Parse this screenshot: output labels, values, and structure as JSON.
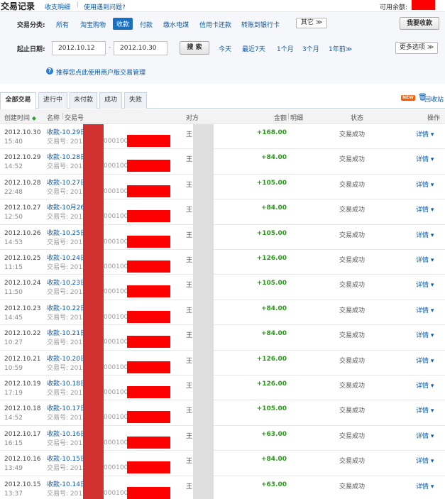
{
  "header": {
    "title": "交易记录",
    "link_statement": "收支明细",
    "link_help": "使用遇到问题?",
    "balance_label": "可用余额:"
  },
  "filter": {
    "category_label": "交易分类:",
    "categories": [
      "所有",
      "淘宝购物",
      "收款",
      "付款",
      "缴水电煤",
      "信用卡还款",
      "转账到银行卡"
    ],
    "selected_category": "收款",
    "other_button": "其它 ≫",
    "collect_button": "我要收款",
    "date_label": "起止日期:",
    "start_date": "2012.10.12",
    "date_separator": "-",
    "end_date": "2012.10.30",
    "search_button": "搜 索",
    "quick_ranges": [
      "今天",
      "最近7天",
      "1个月",
      "3个月",
      "1年前≫"
    ],
    "more_options": "更多选项 ≫",
    "tip": "推荐您点此使用商户版交易管理"
  },
  "tabs": [
    "全部交易",
    "进行中",
    "未付款",
    "成功",
    "失败"
  ],
  "active_tab": "全部交易",
  "recycle": {
    "badge": "NEW",
    "label": "回收站"
  },
  "table": {
    "headers": {
      "created": "创建时间",
      "name": "名称",
      "trade_no": "交易号",
      "counterparty": "对方",
      "amount": "金额",
      "detail": "明细",
      "status": "状态",
      "action": "操作"
    },
    "rows": [
      {
        "date": "2012.10.30",
        "time": "15:40",
        "name": "收款-10.29日",
        "no": "交易号: 2012",
        "no_tail": "0001000",
        "cp": "王",
        "amount": "+168.00",
        "status": "交易成功",
        "detail": "详情 ▾"
      },
      {
        "date": "2012.10.29",
        "time": "14:52",
        "name": "收款-10.28日",
        "no": "交易号: 2012",
        "no_tail": "0001000",
        "cp": "王",
        "amount": "+84.00",
        "status": "交易成功",
        "detail": "详情 ▾"
      },
      {
        "date": "2012.10.28",
        "time": "22:48",
        "name": "收款-10.27日",
        "no": "交易号: 2012",
        "no_tail": "0001000",
        "cp": "王",
        "amount": "+105.00",
        "status": "交易成功",
        "detail": "详情 ▾"
      },
      {
        "date": "2012.10.27",
        "time": "12:50",
        "name": "收款-10月26",
        "no": "交易号: 2012",
        "no_tail": "0001000",
        "cp": "王",
        "amount": "+84.00",
        "status": "交易成功",
        "detail": "详情 ▾"
      },
      {
        "date": "2012.10.26",
        "time": "14:53",
        "name": "收款-10.25日",
        "no": "交易号: 2012",
        "no_tail": "0001000",
        "cp": "王",
        "amount": "+105.00",
        "status": "交易成功",
        "detail": "详情 ▾"
      },
      {
        "date": "2012.10.25",
        "time": "11:15",
        "name": "收款-10.24日",
        "no": "交易号: 2012",
        "no_tail": "0001000",
        "cp": "王",
        "amount": "+126.00",
        "status": "交易成功",
        "detail": "详情 ▾"
      },
      {
        "date": "2012.10.24",
        "time": "11:50",
        "name": "收款-10.23日",
        "no": "交易号: 2012",
        "no_tail": "0001000",
        "cp": "王",
        "amount": "+105.00",
        "status": "交易成功",
        "detail": "详情 ▾"
      },
      {
        "date": "2012.10.23",
        "time": "14:45",
        "name": "收款-10.22日",
        "no": "交易号: 2012",
        "no_tail": "0001000",
        "cp": "王",
        "amount": "+84.00",
        "status": "交易成功",
        "detail": "详情 ▾"
      },
      {
        "date": "2012.10.22",
        "time": "10:27",
        "name": "收款-10.21日",
        "no": "交易号: 2012",
        "no_tail": "0001000",
        "cp": "王",
        "amount": "+84.00",
        "status": "交易成功",
        "detail": "详情 ▾"
      },
      {
        "date": "2012.10.21",
        "time": "10:59",
        "name": "收款-10.20日",
        "no": "交易号: 2012",
        "no_tail": "0001000",
        "cp": "王",
        "amount": "+126.00",
        "status": "交易成功",
        "detail": "详情 ▾"
      },
      {
        "date": "2012.10.19",
        "time": "17:19",
        "name": "收款-10.18日",
        "no": "交易号: 2012",
        "no_tail": "0001000",
        "cp": "王",
        "amount": "+126.00",
        "status": "交易成功",
        "detail": "详情 ▾"
      },
      {
        "date": "2012.10.18",
        "time": "14:52",
        "name": "收款-10.17日",
        "no": "交易号: 2012",
        "no_tail": "0001000",
        "cp": "王",
        "amount": "+105.00",
        "status": "交易成功",
        "detail": "详情 ▾"
      },
      {
        "date": "2012.10.17",
        "time": "16:15",
        "name": "收款-10.16日",
        "no": "交易号: 2012",
        "no_tail": "0001000",
        "cp": "王",
        "amount": "+63.00",
        "status": "交易成功",
        "detail": "详情 ▾"
      },
      {
        "date": "2012.10.16",
        "time": "13:49",
        "name": "收款-10.15日",
        "no": "交易号: 2012",
        "no_tail": "0001000",
        "cp": "王",
        "amount": "+84.00",
        "status": "交易成功",
        "detail": "详情 ▾"
      },
      {
        "date": "2012.10.15",
        "time": "13:37",
        "name": "收款-10.14日",
        "no": "交易号: 2012",
        "no_tail": "0001000",
        "cp": "王",
        "amount": "+63.00",
        "status": "交易成功",
        "detail": "详情 ▾"
      }
    ]
  },
  "colors": {
    "link": "#0b59a8",
    "amount": "#2a9a1a",
    "selected_category_bg": "#1a6fbf",
    "redaction_red": "#ff0000",
    "redaction_dark_red": "#d0302f",
    "redaction_gray": "#dedede"
  }
}
